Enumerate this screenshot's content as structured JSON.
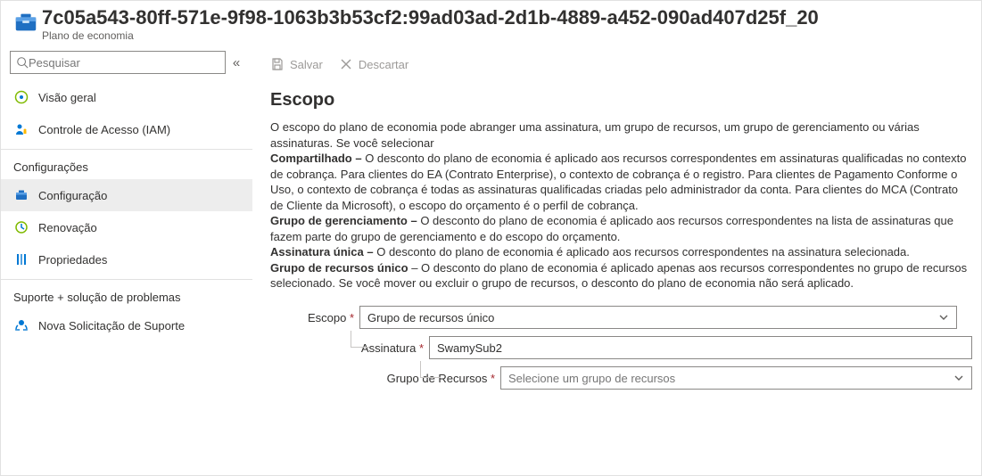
{
  "header": {
    "title": "7c05a543-80ff-571e-9f98-1063b3b53cf2:99ad03ad-2d1b-4889-a452-090ad407d25f_20",
    "subtitle": "Plano de economia"
  },
  "sidebar": {
    "search_placeholder": "Pesquisar",
    "items_top": [
      {
        "label": "Visão geral",
        "icon": "overview"
      },
      {
        "label": "Controle de Acesso (IAM)",
        "icon": "iam"
      }
    ],
    "group_settings": "Configurações",
    "items_settings": [
      {
        "label": "Configuração",
        "icon": "config",
        "selected": true
      },
      {
        "label": "Renovação",
        "icon": "renew"
      },
      {
        "label": "Propriedades",
        "icon": "props"
      }
    ],
    "group_support": "Suporte + solução de problemas",
    "items_support": [
      {
        "label": "Nova Solicitação de Suporte",
        "icon": "support"
      }
    ]
  },
  "toolbar": {
    "save": "Salvar",
    "discard": "Descartar"
  },
  "main": {
    "section_title": "Escopo",
    "intro": "O escopo do plano de economia pode abranger uma assinatura, um grupo de recursos, um grupo de gerenciamento ou várias assinaturas. Se você selecionar",
    "shared_b": "Compartilhado – ",
    "shared_t": "O desconto do plano de economia é aplicado aos recursos correspondentes em assinaturas qualificadas no contexto de cobrança. Para clientes do EA (Contrato Enterprise), o contexto de cobrança é o registro. Para clientes de Pagamento Conforme o Uso, o contexto de cobrança é todas as assinaturas qualificadas criadas pelo administrador da conta. Para clientes do MCA (Contrato de Cliente da Microsoft), o escopo do orçamento é o perfil de cobrança.",
    "mg_b": "Grupo de gerenciamento – ",
    "mg_t": "O desconto do plano de economia é aplicado aos recursos correspondentes na lista de assinaturas que fazem parte do grupo de gerenciamento e do escopo do orçamento.",
    "single_b": "Assinatura única – ",
    "single_t": "O desconto do plano de economia é aplicado aos recursos correspondentes na assinatura selecionada.",
    "rg_b": "Grupo de recursos único",
    "rg_t": " – O desconto do plano de economia é aplicado apenas aos recursos correspondentes no grupo de recursos selecionado. Se você mover ou excluir o grupo de recursos, o desconto do plano de economia não será aplicado.",
    "form": {
      "scope_label": "Escopo",
      "scope_value": "Grupo de recursos único",
      "sub_label": "Assinatura",
      "sub_value": "SwamySub2",
      "rg_label": "Grupo de Recursos",
      "rg_placeholder": "Selecione um grupo de recursos"
    }
  }
}
